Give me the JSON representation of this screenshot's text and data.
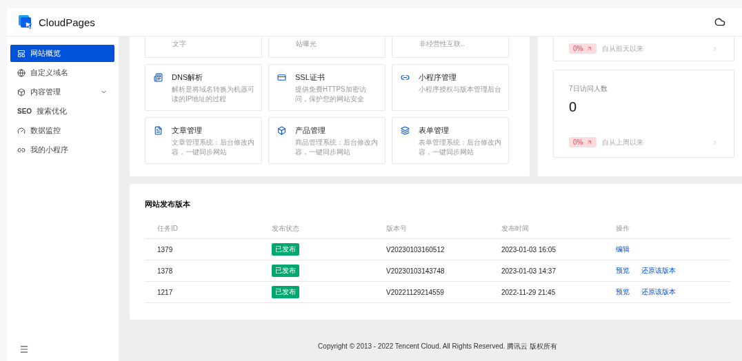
{
  "header": {
    "brand": "CloudPages"
  },
  "sidebar": {
    "items": [
      {
        "label": "网站概览",
        "selected": true
      },
      {
        "label": "自定义域名",
        "selected": false
      },
      {
        "label": "内容管理",
        "selected": false,
        "expanded": false
      },
      {
        "icon_text": "SEO",
        "label": "搜索优化",
        "selected": false
      },
      {
        "label": "数据监控",
        "selected": false
      },
      {
        "label": "我的小程序",
        "selected": false
      }
    ]
  },
  "features": [
    {
      "desc": "文字"
    },
    {
      "desc": "站曝光"
    },
    {
      "desc": "非经营性互联.."
    },
    {
      "title": "DNS解析",
      "desc": "解析是将域名转换为机器可读的IP地址的过程"
    },
    {
      "title": "SSL证书",
      "desc": "提供免费HTTPS加密访问，保护您的网站安全"
    },
    {
      "title": "小程序管理",
      "desc": "小程序授权与版本管理后台"
    },
    {
      "title": "文章管理",
      "desc": "文章管理系统：后台修改内容，一键同步网站"
    },
    {
      "title": "产品管理",
      "desc": "商品管理系统：后台修改内容，一键同步网站"
    },
    {
      "title": "表单管理",
      "desc": "表单管理系统：后台修改内容，一键同步网站"
    }
  ],
  "stats": [
    {
      "change": "0%",
      "since": "自从前天以来"
    },
    {
      "label": "7日访问人数",
      "value": "0",
      "change": "0%",
      "since": "自从上周以来"
    }
  ],
  "releases": {
    "title": "网站发布版本",
    "columns": [
      "任务ID",
      "发布状态",
      "版本号",
      "发布时间",
      "操作"
    ],
    "rows": [
      {
        "id": "1379",
        "status": "已发布",
        "version": "V20230103160512",
        "time": "2023-01-03 16:05",
        "actions": [
          "编辑"
        ]
      },
      {
        "id": "1378",
        "status": "已发布",
        "version": "V20230103143748",
        "time": "2023-01-03 14:37",
        "actions": [
          "预览",
          "还原该版本"
        ]
      },
      {
        "id": "1217",
        "status": "已发布",
        "version": "V20221129214559",
        "time": "2022-11-29 21:45",
        "actions": [
          "预览",
          "还原该版本"
        ]
      }
    ]
  },
  "footer": "Copyright © 2013 - 2022 Tencent Cloud. All Rights Reserved. 腾讯云 版权所有"
}
